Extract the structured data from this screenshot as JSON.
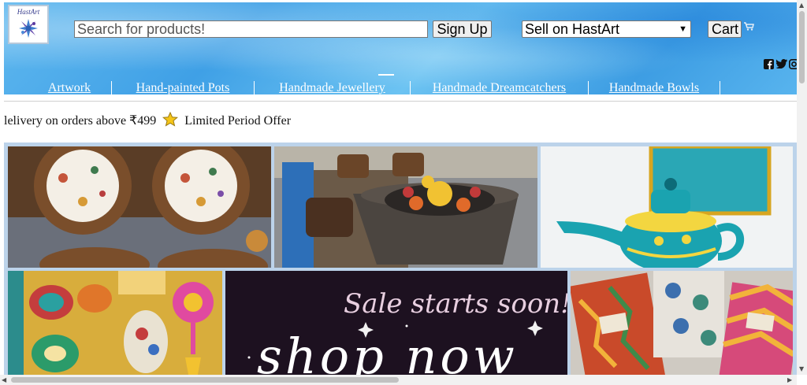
{
  "header": {
    "logo_text": "HastArt",
    "search": {
      "placeholder": "Search for products!",
      "value": ""
    },
    "signup_label": "Sign Up",
    "sell_select": {
      "selected": "Sell on HastArt"
    },
    "cart_label": "Cart",
    "icons": [
      "facebook-icon",
      "twitter-icon",
      "instagram-icon",
      "cart-icon"
    ]
  },
  "nav": {
    "items": [
      {
        "label": "Artwork"
      },
      {
        "label": "Hand-painted Pots"
      },
      {
        "label": "Handmade Jewellery"
      },
      {
        "label": "Handmade Dreamcatchers"
      },
      {
        "label": "Handmade Bowls"
      }
    ]
  },
  "offer": {
    "text_before": "lelivery on orders above ₹499",
    "text_after": "Limited Period Offer"
  },
  "banner": {
    "sale_text": "Sale starts soon!",
    "shop_text": "shop now"
  },
  "colors": {
    "header_blue": "#3fa0e6",
    "gallery_border": "#bcd3ea"
  }
}
